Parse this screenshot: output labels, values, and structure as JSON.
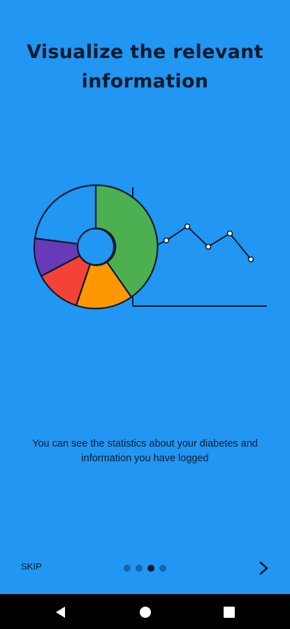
{
  "onboarding": {
    "title": "Visualize the relevant information",
    "description": "You can see the statistics about your diabetes and information you have logged",
    "skip_label": "SKIP",
    "page_indicator": {
      "total": 4,
      "active_index": 2
    },
    "next_icon": "chevron-right-icon"
  },
  "illustration": {
    "pie_colors": [
      "#4CAF50",
      "#FF9800",
      "#F44336",
      "#673AB7",
      "#2196F3"
    ],
    "line_color": "#0d1b2a"
  },
  "system_nav": {
    "back_icon": "back-triangle-icon",
    "home_icon": "home-circle-icon",
    "recents_icon": "recents-square-icon"
  },
  "colors": {
    "background": "#2196F3",
    "text": "#0d1b2a",
    "dot_inactive": "#1565a8",
    "dot_active": "#0d1b2a"
  }
}
